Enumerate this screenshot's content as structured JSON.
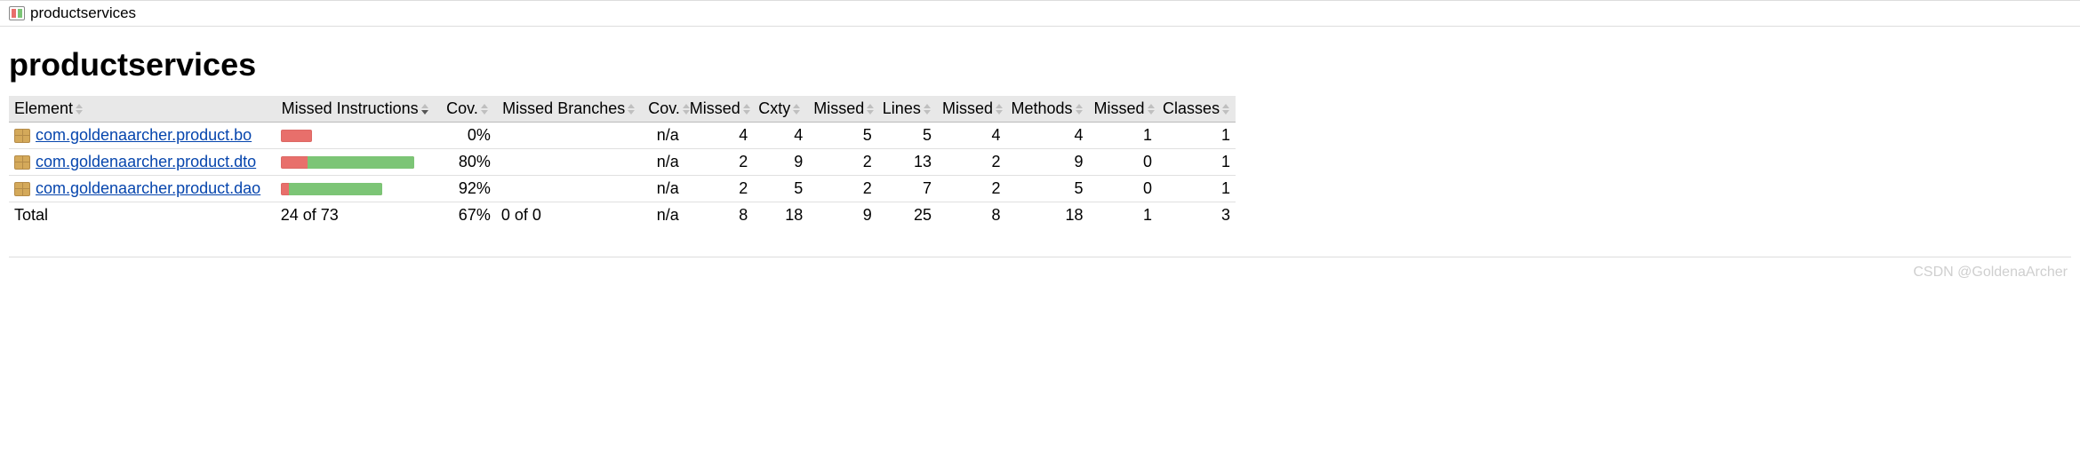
{
  "breadcrumb": {
    "project": "productservices"
  },
  "title": "productservices",
  "headers": {
    "element": "Element",
    "missed_instr": "Missed Instructions",
    "cov_instr": "Cov.",
    "missed_branch": "Missed Branches",
    "cov_branch": "Cov.",
    "missed_cxty": "Missed",
    "cxty": "Cxty",
    "missed_lines": "Missed",
    "lines": "Lines",
    "missed_methods": "Missed",
    "methods": "Methods",
    "missed_classes": "Missed",
    "classes": "Classes"
  },
  "chart_data": {
    "type": "table",
    "title": "JaCoCo coverage — productservices",
    "columns": [
      "Element",
      "Missed Instructions",
      "Instruction Cov.",
      "Missed Branches",
      "Branch Cov.",
      "Missed Cxty",
      "Cxty",
      "Missed Lines",
      "Lines",
      "Missed Methods",
      "Methods",
      "Missed Classes",
      "Classes"
    ],
    "rows": [
      {
        "element": "com.goldenaarcher.product.bo",
        "instr_bar_rel": 0.23,
        "instr_cov_pct": 0,
        "branch_bar_rel": 0,
        "branch_cov": "n/a",
        "m_cxty": 4,
        "cxty": 4,
        "m_lines": 5,
        "lines": 5,
        "m_methods": 4,
        "methods": 4,
        "m_classes": 1,
        "classes": 1
      },
      {
        "element": "com.goldenaarcher.product.dto",
        "instr_bar_rel": 1.0,
        "instr_cov_pct": 80,
        "branch_bar_rel": 0,
        "branch_cov": "n/a",
        "m_cxty": 2,
        "cxty": 9,
        "m_lines": 2,
        "lines": 13,
        "m_methods": 2,
        "methods": 9,
        "m_classes": 0,
        "classes": 1
      },
      {
        "element": "com.goldenaarcher.product.dao",
        "instr_bar_rel": 0.76,
        "instr_cov_pct": 92,
        "branch_bar_rel": 0,
        "branch_cov": "n/a",
        "m_cxty": 2,
        "cxty": 5,
        "m_lines": 2,
        "lines": 7,
        "m_methods": 2,
        "methods": 5,
        "m_classes": 0,
        "classes": 1
      }
    ],
    "total": {
      "element": "Total",
      "instr_text": "24 of 73",
      "instr_cov_pct": 67,
      "branch_text": "0 of 0",
      "branch_cov": "n/a",
      "m_cxty": 8,
      "cxty": 18,
      "m_lines": 9,
      "lines": 25,
      "m_methods": 8,
      "methods": 18,
      "m_classes": 1,
      "classes": 3
    }
  },
  "watermark": "CSDN @GoldenaArcher"
}
